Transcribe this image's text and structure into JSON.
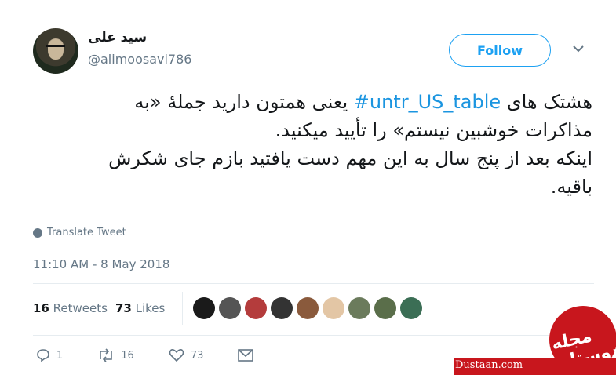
{
  "author": {
    "name": "سید علی",
    "handle": "@alimoosavi786"
  },
  "follow_label": "Follow",
  "caret_icon": "chevron-down-icon",
  "tweet": {
    "line1_before": "هشتک های ",
    "hashtag": "#untr_US_table",
    "line1_after": " یعنی همتون دارید جملهٔ «به",
    "line2": "مذاکرات خوشبین نیستم» را تأیید میکنید.",
    "line3": "اینکه بعد از پنج سال به این مهم دست یافتید بازم جای شکرش",
    "line4": "باقیه."
  },
  "translate_label": "Translate Tweet",
  "timestamp": "11:10 AM - 8 May 2018",
  "stats": {
    "retweets_count": "16",
    "retweets_label": "Retweets",
    "likes_count": "73",
    "likes_label": "Likes"
  },
  "actions": {
    "reply_count": "1",
    "retweet_count": "16",
    "like_count": "73"
  },
  "liker_colors": [
    "#1a1a1a",
    "#555555",
    "#b43c3c",
    "#333333",
    "#8a5a3c",
    "#e3c6a5",
    "#6b7b5c",
    "#5a6e4a",
    "#3b6e55"
  ],
  "accent_color": "#1da1f2",
  "watermark": {
    "script": "مجله دوستان",
    "url": "Dustaan.com"
  }
}
